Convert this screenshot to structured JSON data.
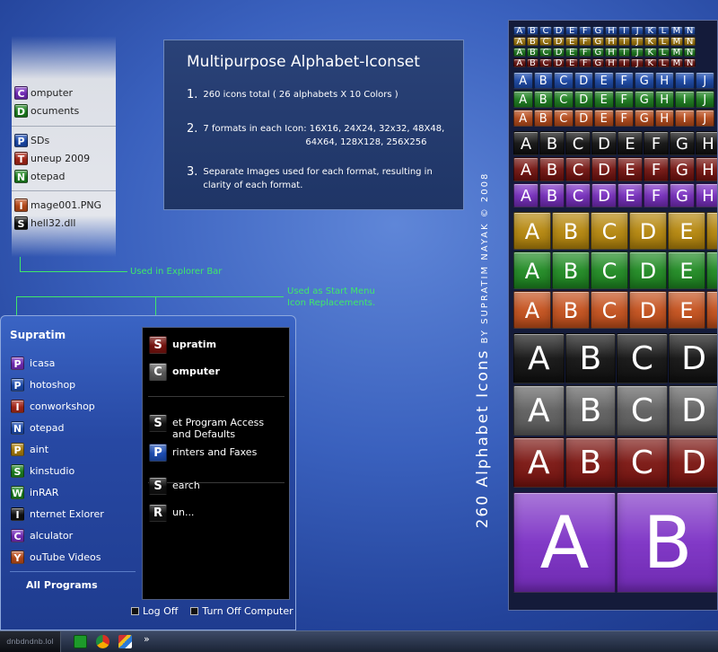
{
  "colors": {
    "purple": "#7b2fc4",
    "green": "#1f8a22",
    "blue": "#1d4fb8",
    "red": "#b02a1a",
    "darkred": "#7a1410",
    "gold": "#b5860c",
    "orange": "#c4501c",
    "black": "#111111",
    "gray": "#5e5e5e",
    "annotation": "#3fe86a"
  },
  "explorer_bar": {
    "groups": [
      [
        {
          "letter": "C",
          "label": "omputer",
          "color": "purple"
        },
        {
          "letter": "D",
          "label": "ocuments",
          "color": "green"
        }
      ],
      [
        {
          "letter": "P",
          "label": "SDs",
          "color": "blue"
        },
        {
          "letter": "T",
          "label": "uneup 2009",
          "color": "red"
        },
        {
          "letter": "N",
          "label": "otepad",
          "color": "green"
        }
      ],
      [
        {
          "letter": "I",
          "label": "mage001.PNG",
          "color": "orange"
        },
        {
          "letter": "S",
          "label": "hell32.dll",
          "color": "black"
        }
      ]
    ]
  },
  "annotations": {
    "explorer": "Used in Explorer Bar",
    "start_menu_line1": "Used as Start Menu",
    "start_menu_line2": "Icon Replacements."
  },
  "info": {
    "title": "Multipurpose Alphabet-Iconset",
    "points": [
      {
        "num": "1.",
        "line1": "260 icons total ( 26 alphabets X 10 Colors )",
        "line2": ""
      },
      {
        "num": "2.",
        "line1": "7 formats in each Icon: 16X16, 24X24, 32x32, 48X48,",
        "line2": "64X64, 128X128, 256X256"
      },
      {
        "num": "3.",
        "line1": "Separate Images used for each format, resulting in",
        "line2": "clarity of each format."
      }
    ]
  },
  "start_menu": {
    "user": "Supratim",
    "left_items": [
      {
        "letter": "P",
        "label": "icasa",
        "color": "purple"
      },
      {
        "letter": "P",
        "label": "hotoshop",
        "color": "blue"
      },
      {
        "letter": "I",
        "label": "conworkshop",
        "color": "red"
      },
      {
        "letter": "N",
        "label": "otepad",
        "color": "blue"
      },
      {
        "letter": "P",
        "label": "aint",
        "color": "gold"
      },
      {
        "letter": "S",
        "label": "kinstudio",
        "color": "green"
      },
      {
        "letter": "W",
        "label": "inRAR",
        "color": "green"
      },
      {
        "letter": "I",
        "label": "nternet Exlorer",
        "color": "black"
      },
      {
        "letter": "C",
        "label": "alculator",
        "color": "purple"
      },
      {
        "letter": "Y",
        "label": "ouTube Videos",
        "color": "orange"
      }
    ],
    "all_programs": "All Programs",
    "right_items": [
      {
        "letter": "S",
        "label": "upratim",
        "color": "darkred",
        "bold": true
      },
      {
        "letter": "C",
        "label": "omputer",
        "color": "gray",
        "bold": true
      },
      {
        "letter": "S",
        "label": "et Program Access and Defaults",
        "color": "black",
        "bold": false
      },
      {
        "letter": "P",
        "label": "rinters and Faxes",
        "color": "blue",
        "bold": false
      },
      {
        "letter": "S",
        "label": "earch",
        "color": "black",
        "bold": false
      },
      {
        "letter": "R",
        "label": "un...",
        "color": "black",
        "bold": false
      }
    ],
    "log_off": "Log Off",
    "turn_off": "Turn Off Computer"
  },
  "taskbar": {
    "start_label": "dnbdndnb.lol",
    "more": "»"
  },
  "preview": {
    "title": "260 Alphabet Icons",
    "subtitle": "BY SUPRATIM NAYAK © 2008",
    "rows": [
      {
        "letters": "ABCDEFGHIJKLMN",
        "color": "blue"
      },
      {
        "letters": "ABCDEFGHIJKLMN",
        "color": "gold"
      },
      {
        "letters": "ABCDEFGHIJKLMN",
        "color": "green"
      },
      {
        "letters": "ABCDEFGHIJKLMN",
        "color": "darkred"
      },
      {
        "letters": "ABCDEFGHIJ",
        "color": "blue"
      },
      {
        "letters": "ABCDEFGHIJ",
        "color": "green"
      },
      {
        "letters": "ABCDEFGHIJ",
        "color": "orange"
      },
      {
        "letters": "ABCDEFGH",
        "color": "black"
      },
      {
        "letters": "ABCDEFGH",
        "color": "darkred"
      },
      {
        "letters": "ABCDEFGH",
        "color": "purple"
      },
      {
        "letters": "ABCDEF",
        "color": "gold"
      },
      {
        "letters": "ABCDEF",
        "color": "green"
      },
      {
        "letters": "ABCDEF",
        "color": "orange"
      },
      {
        "letters": "ABCD",
        "color": "black"
      },
      {
        "letters": "ABCD",
        "color": "gray"
      },
      {
        "letters": "ABCD",
        "color": "darkred"
      },
      {
        "letters": "AB",
        "color": "purple"
      }
    ]
  }
}
